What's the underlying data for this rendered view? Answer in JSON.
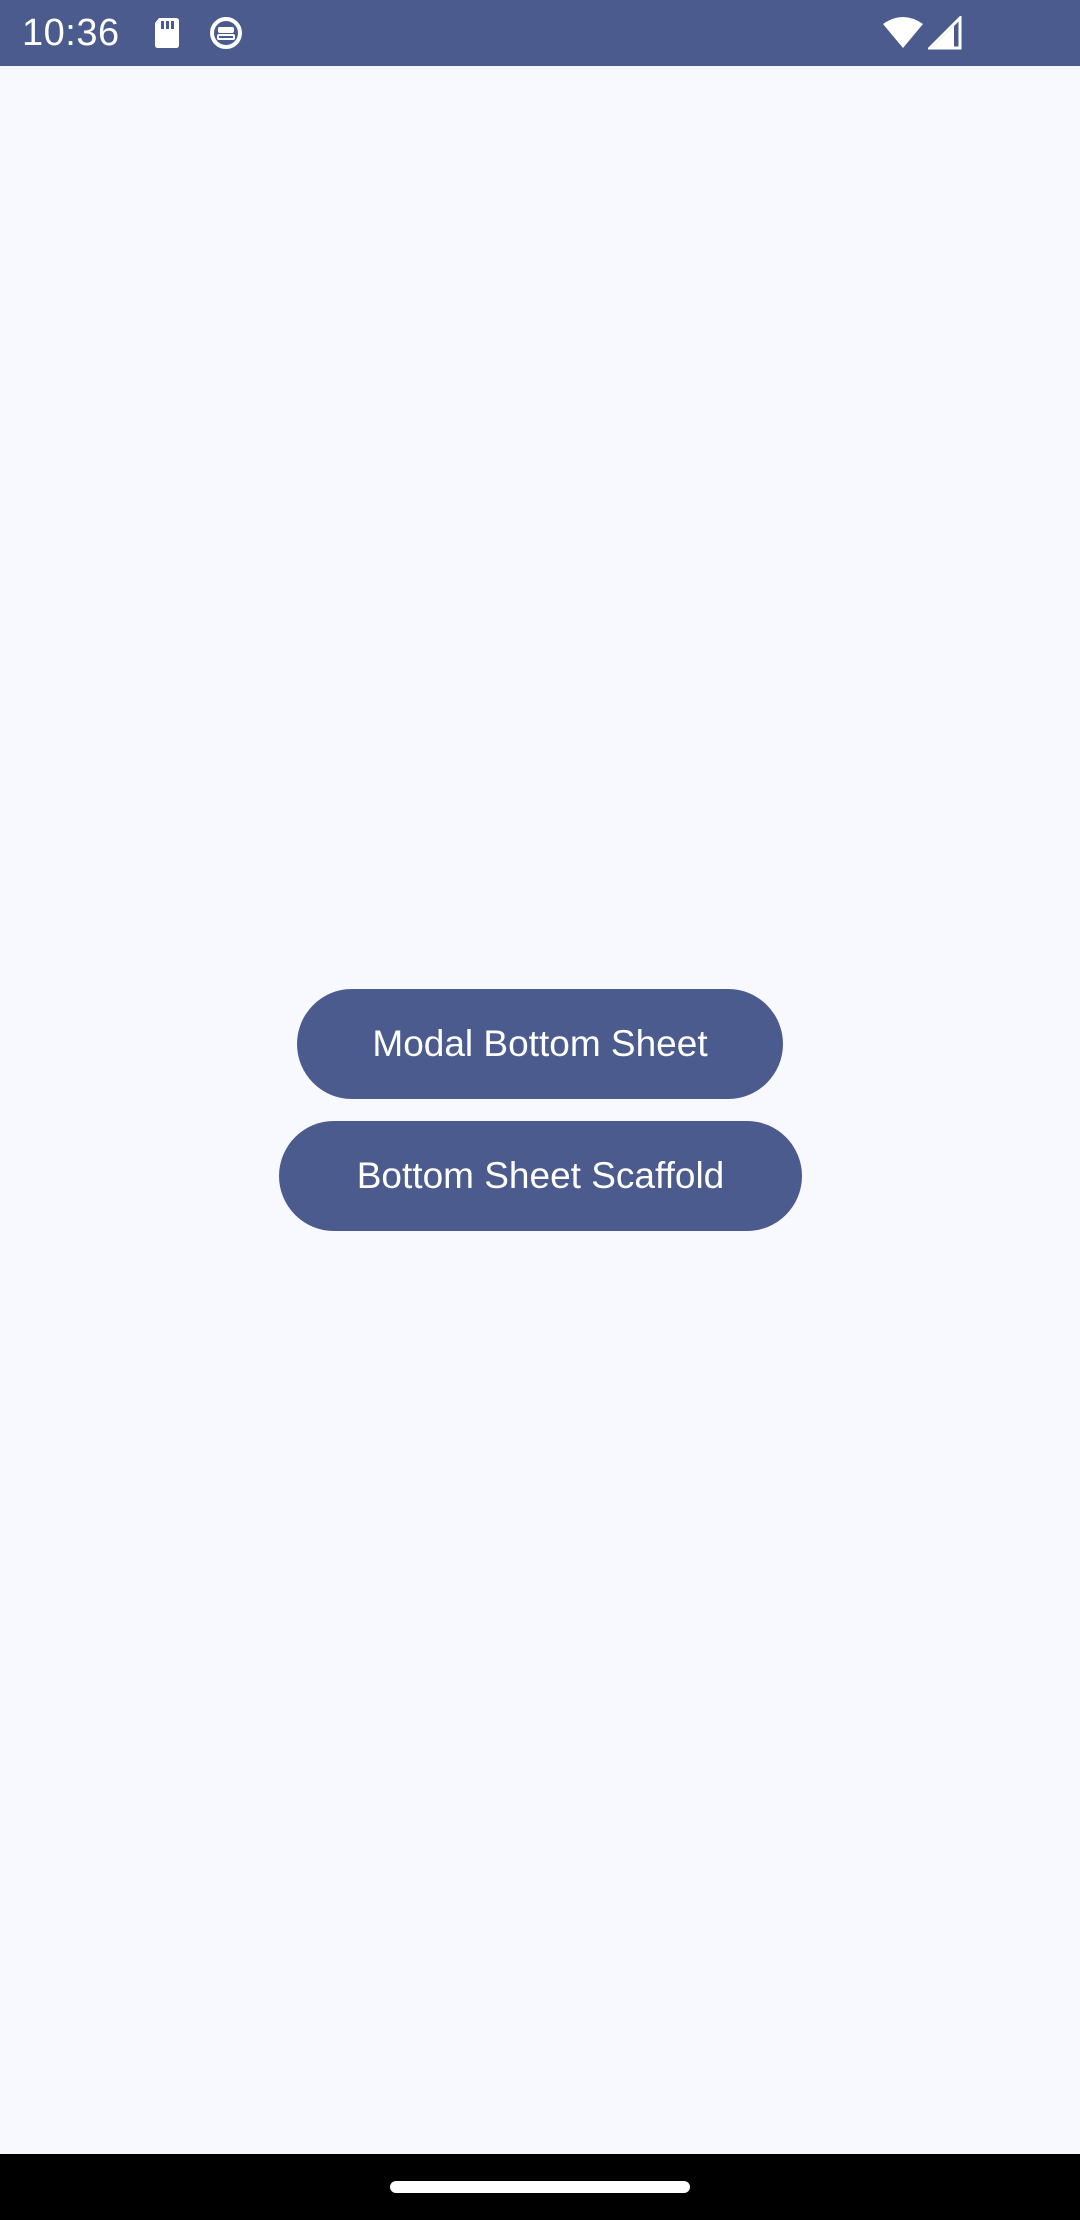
{
  "status_bar": {
    "time": "10:36",
    "icons": [
      "sd-card-icon",
      "sync-icon",
      "wifi-icon",
      "signal-icon"
    ],
    "color": "#4b5b8d"
  },
  "main": {
    "buttons": [
      {
        "label": "Modal Bottom Sheet"
      },
      {
        "label": "Bottom Sheet Scaffold"
      }
    ],
    "accent_color": "#4b5b8d",
    "background_color": "#f8f9fe"
  },
  "nav_bar": {
    "gesture": "home-handle"
  }
}
